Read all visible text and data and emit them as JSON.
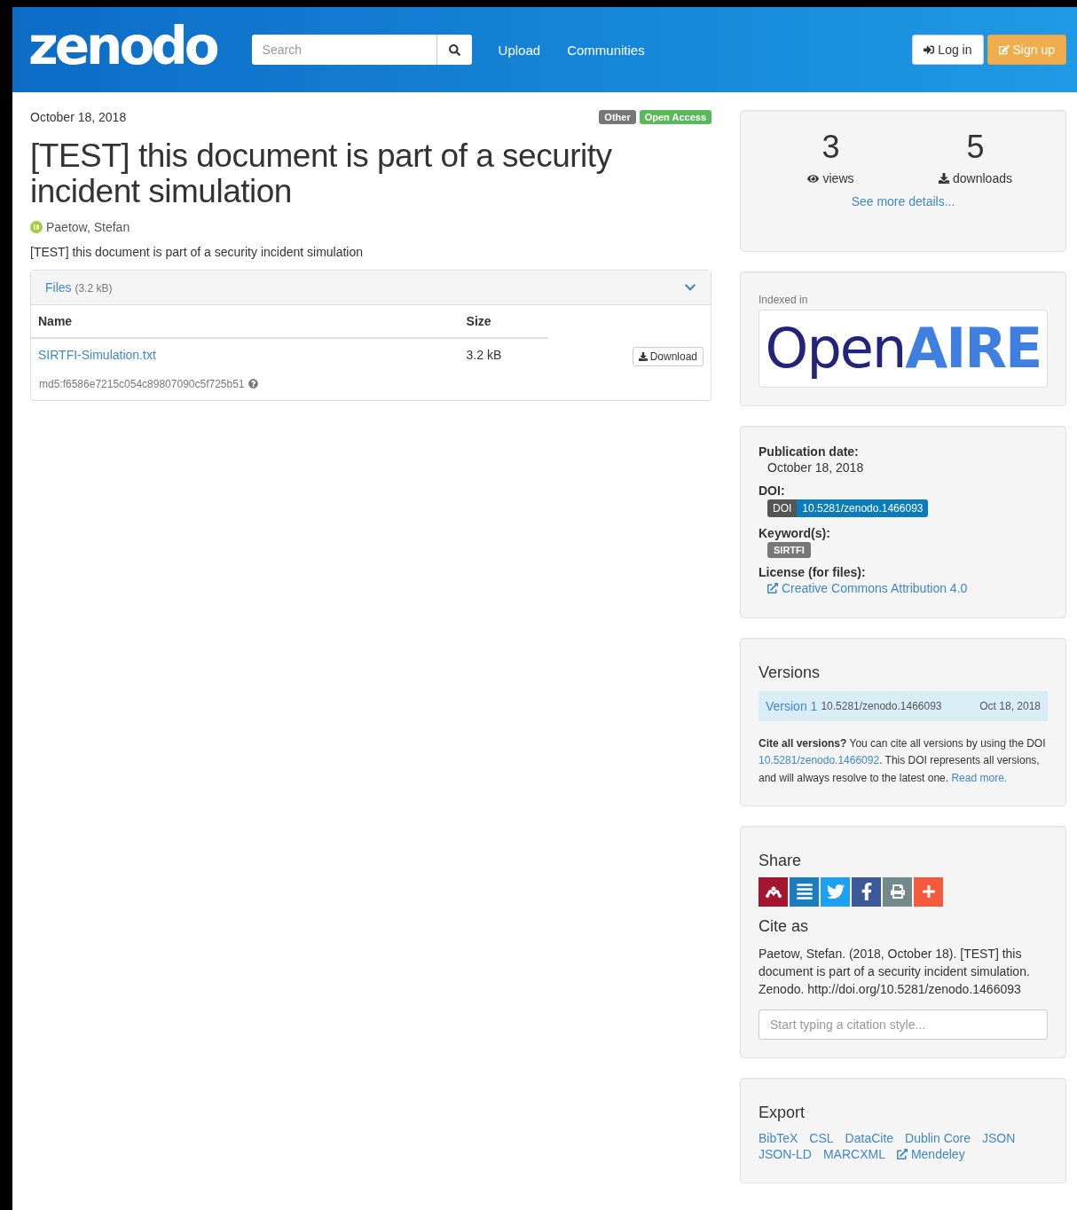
{
  "header": {
    "logo": "zenodo",
    "search": {
      "placeholder": "Search"
    },
    "nav": [
      "Upload",
      "Communities"
    ],
    "login": "Log in",
    "signup": "Sign up"
  },
  "record": {
    "date": "October 18, 2018",
    "badges": [
      {
        "label": "Other",
        "color": "#777777"
      },
      {
        "label": "Open Access",
        "color": "#5cb85c"
      }
    ],
    "title": "[TEST] this document is part of a security incident simulation",
    "author": "Paetow, Stefan",
    "description": "[TEST] this document is part of a security incident simulation",
    "files": {
      "title": "Files",
      "size": "(3.2 kB)",
      "expanded": true,
      "columns": [
        "Name",
        "Size"
      ],
      "rows": [
        {
          "name": "SIRTFI-Simulation.txt",
          "size": "3.2 kB",
          "action": "Download",
          "checksum": "md5:f6586e7215c054c89807090c5f725b51"
        }
      ]
    }
  },
  "stats": {
    "views": "3",
    "views_label": "views",
    "downloads": "5",
    "downloads_label": "downloads",
    "link": "See more details..."
  },
  "indexed": {
    "label": "Indexed in",
    "logo": [
      "Open",
      "AIRE"
    ]
  },
  "details": [
    {
      "label": "Publication date:",
      "kind": "text",
      "value": "October 18, 2018"
    },
    {
      "label": "DOI:",
      "kind": "doi",
      "badge": {
        "prefix": "DOI",
        "doi": "10.5281/zenodo.1466093"
      }
    },
    {
      "label": "Keyword(s):",
      "kind": "tag",
      "value": "SIRTFI"
    },
    {
      "label": "License (for files):",
      "kind": "link",
      "value": "Creative Commons Attribution 4.0"
    }
  ],
  "versions": {
    "title": "Versions",
    "items": [
      {
        "label": "Version 1",
        "doi": "10.5281/zenodo.1466093",
        "date": "Oct 18, 2018",
        "selected": true
      }
    ],
    "note": [
      {
        "kind": "text",
        "text": "**Cite all versions?** You can cite all versions by using the DOI "
      },
      {
        "kind": "link",
        "text": "10.5281/zenodo.1466092"
      },
      {
        "kind": "text",
        "text": ". This DOI represents all versions, and will always resolve to the latest one. "
      },
      {
        "kind": "link",
        "text": "Read more."
      }
    ]
  },
  "share": {
    "title": "Share",
    "buttons": [
      {
        "kind": "mendeley",
        "color": "#a5152f"
      },
      {
        "kind": "list",
        "color": "#1d7cc0"
      },
      {
        "kind": "twitter",
        "color": "#1da1f2"
      },
      {
        "kind": "facebook",
        "color": "#3b5998"
      },
      {
        "kind": "print",
        "color": "#738a8d"
      },
      {
        "kind": "more",
        "color": "#f55a3e"
      }
    ]
  },
  "cite": {
    "title": "Cite as",
    "text": "Paetow, Stefan. (2018, October 18). [TEST] this document is part of a security incident simulation. Zenodo. http://doi.org/10.5281/zenodo.1466093",
    "placeholder": "Start typing a citation style..."
  },
  "export": {
    "title": "Export",
    "links": [
      {
        "label": "BibTeX",
        "external": false
      },
      {
        "label": "CSL",
        "external": false
      },
      {
        "label": "DataCite",
        "external": false
      },
      {
        "label": "Dublin Core",
        "external": false
      },
      {
        "label": "JSON",
        "external": false
      },
      {
        "label": "JSON-LD",
        "external": false
      },
      {
        "label": "MARCXML",
        "external": false
      },
      {
        "label": "Mendeley",
        "external": true
      }
    ]
  }
}
